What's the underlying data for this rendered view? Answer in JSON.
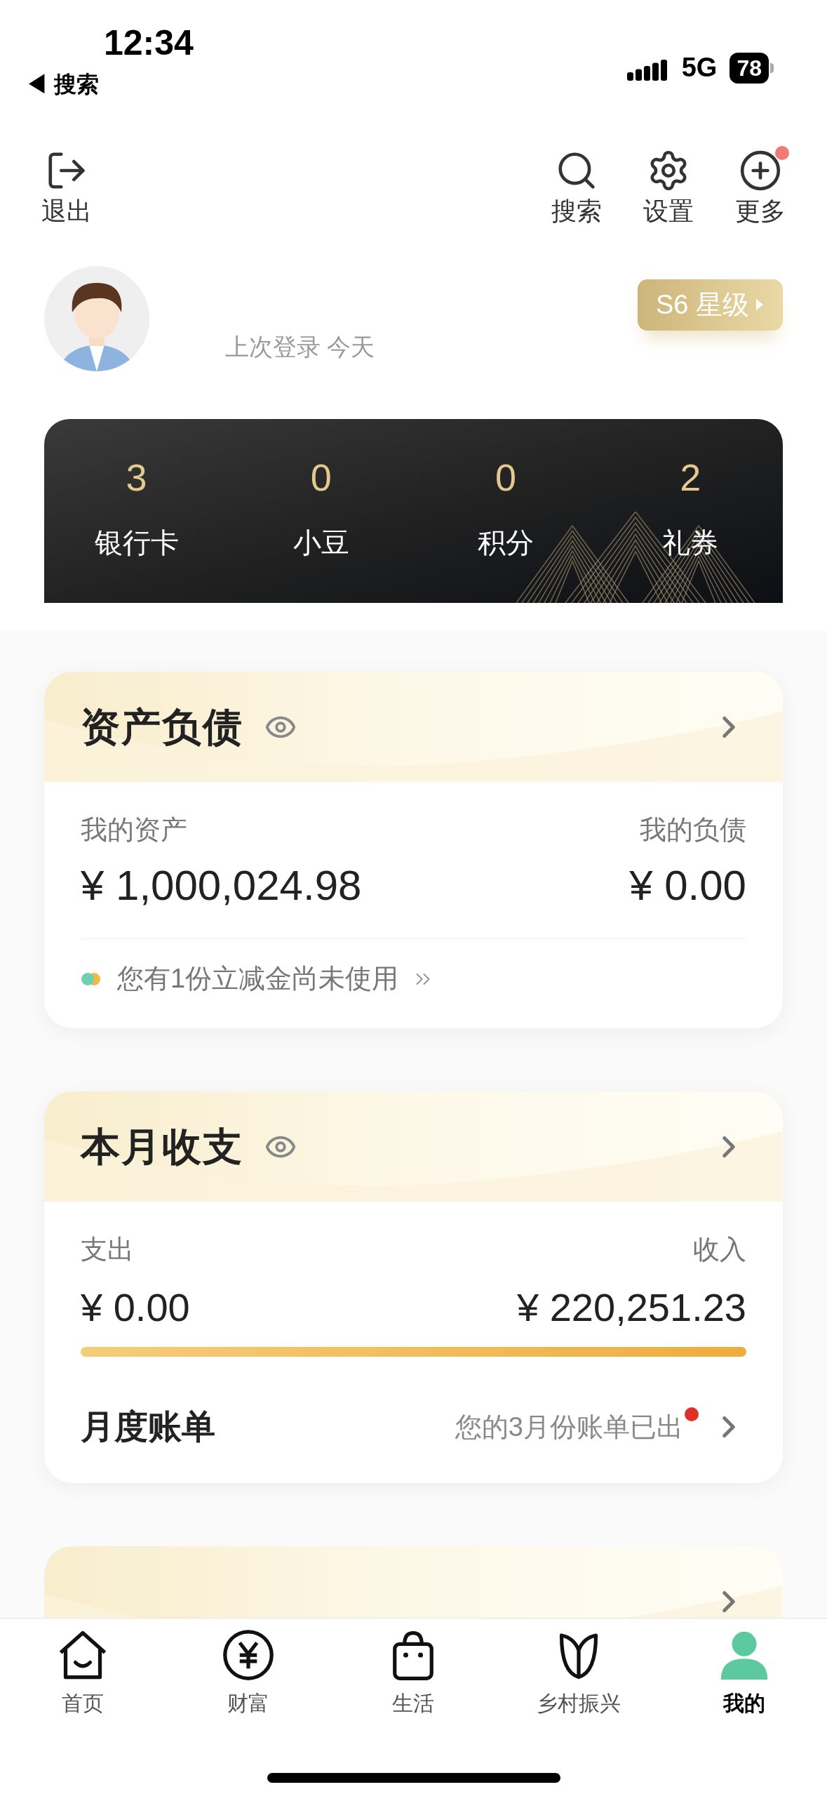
{
  "status_bar": {
    "time": "12:34",
    "back_label": "◀ 搜索",
    "network": "5G",
    "battery": "78"
  },
  "top_actions": [
    {
      "kind": "exit",
      "label": "退出",
      "badge": false
    },
    {
      "kind": "search",
      "label": "搜索",
      "badge": false
    },
    {
      "kind": "settings",
      "label": "设置",
      "badge": false
    },
    {
      "kind": "more",
      "label": "更多",
      "badge": true
    }
  ],
  "profile": {
    "last_login": "上次登录 今天",
    "level_badge": "S6 星级"
  },
  "stats": [
    {
      "value": "3",
      "label": "银行卡"
    },
    {
      "value": "0",
      "label": "小豆"
    },
    {
      "value": "0",
      "label": "积分"
    },
    {
      "value": "2",
      "label": "礼券"
    }
  ],
  "assets_card": {
    "title": "资产负债",
    "left_label": "我的资产",
    "left_amount": "¥ 1,000,024.98",
    "right_label": "我的负债",
    "right_amount": "¥ 0.00",
    "hint": "您有1份立减金尚未使用"
  },
  "income_card": {
    "title": "本月收支",
    "left_label": "支出",
    "left_amount": "¥ 0.00",
    "right_label": "收入",
    "right_amount": "¥ 220,251.23",
    "bill_title": "月度账单",
    "bill_note": "您的3月份账单已出",
    "bill_unread": true
  },
  "tabs": [
    {
      "kind": "home",
      "label": "首页",
      "selected": false
    },
    {
      "kind": "wealth",
      "label": "财富",
      "selected": false
    },
    {
      "kind": "life",
      "label": "生活",
      "selected": false
    },
    {
      "kind": "village",
      "label": "乡村振兴",
      "selected": false
    },
    {
      "kind": "mine",
      "label": "我的",
      "selected": true
    }
  ]
}
